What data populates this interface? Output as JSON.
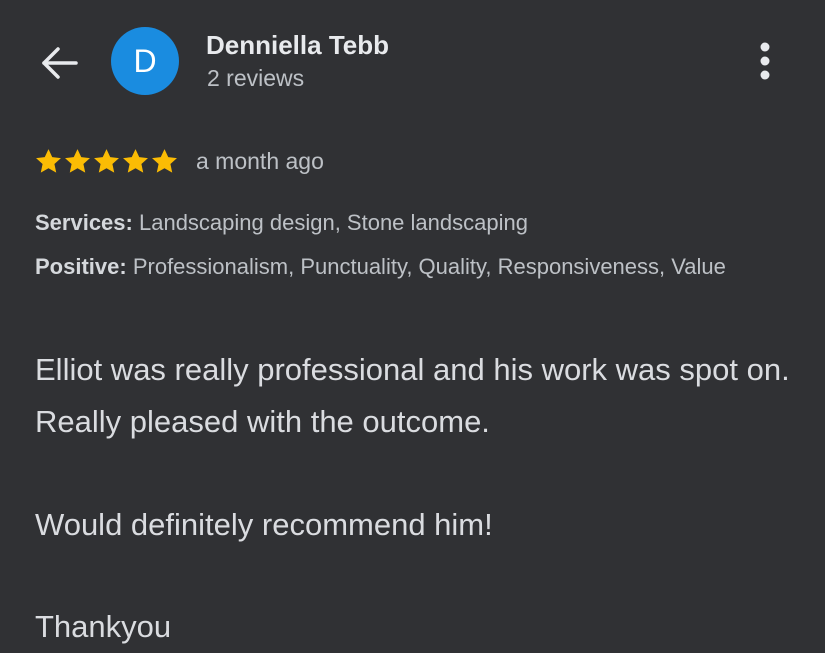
{
  "header": {
    "reviewer_name": "Denniella Tebb",
    "review_count": "2 reviews",
    "avatar_initial": "D",
    "avatar_color": "#1a8ce0",
    "back_icon": "arrow-back-icon",
    "more_icon": "more-vert-icon"
  },
  "review": {
    "rating": 5,
    "rating_max": 5,
    "star_color": "#fbbc04",
    "timestamp": "a month ago",
    "services_label": "Services:",
    "services_value": "Landscaping design, Stone landscaping",
    "positive_label": "Positive:",
    "positive_value": "Professionalism, Punctuality, Quality, Responsiveness, Value",
    "paragraphs": [
      "Elliot was really professional and his work was spot on. Really pleased with the outcome.",
      "Would definitely recommend him!",
      "Thankyou"
    ]
  }
}
